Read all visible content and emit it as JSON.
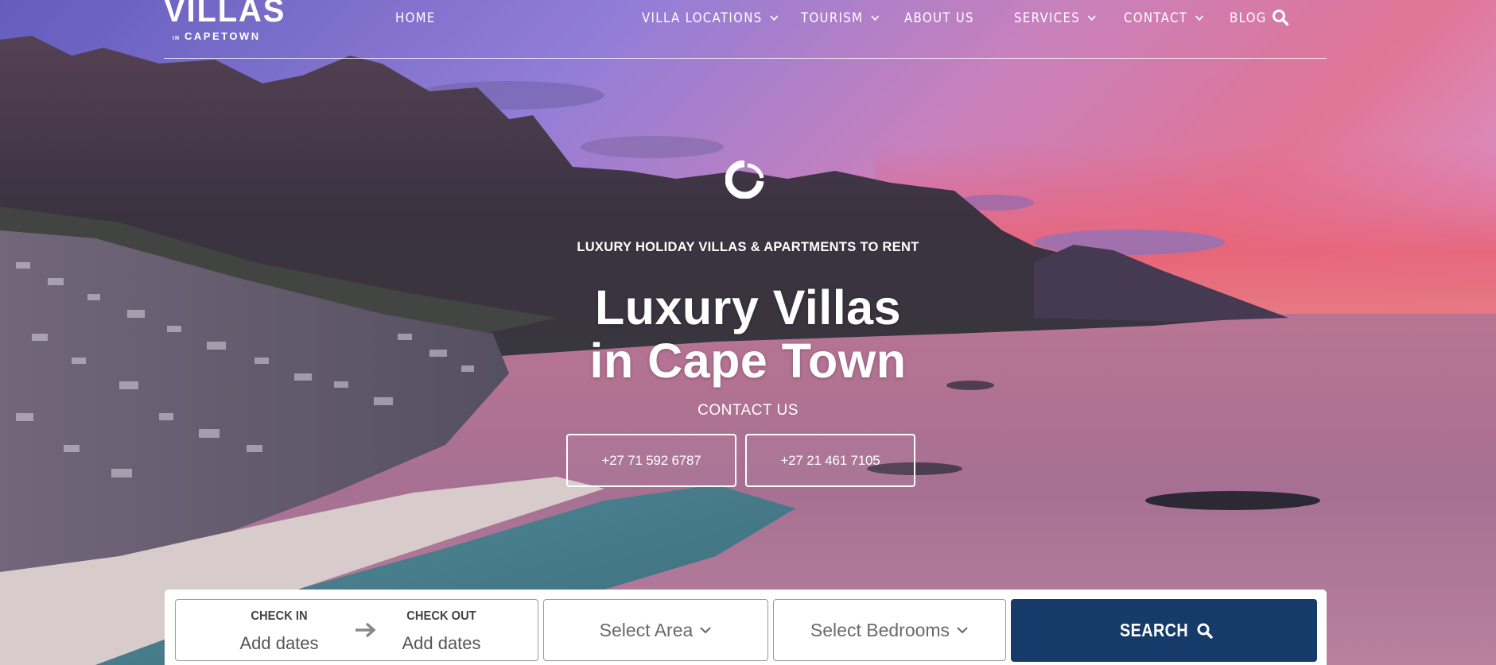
{
  "brand": {
    "logo_main": "VILLAS",
    "logo_small": "IN",
    "logo_city": "CAPETOWN"
  },
  "nav": {
    "items": [
      {
        "label": "HOME",
        "has_dropdown": false
      },
      {
        "label": "VILLA LOCATIONS",
        "has_dropdown": true
      },
      {
        "label": "TOURISM",
        "has_dropdown": true
      },
      {
        "label": "ABOUT US",
        "has_dropdown": false
      },
      {
        "label": "SERVICES",
        "has_dropdown": true
      },
      {
        "label": "CONTACT",
        "has_dropdown": true
      },
      {
        "label": "BLOG",
        "has_dropdown": false
      }
    ],
    "search_icon": "search-icon"
  },
  "hero": {
    "tagline": "LUXURY HOLIDAY VILLAS & APARTMENTS TO RENT",
    "title_line1": "Luxury Villas",
    "title_line2": "in Cape Town",
    "contact_label": "CONTACT US",
    "phone_1": "+27 71 592 6787",
    "phone_2": "+27 21 461 7105"
  },
  "booking": {
    "check_in_label": "CHECK IN",
    "check_in_value": "Add dates",
    "check_out_label": "CHECK OUT",
    "check_out_value": "Add dates",
    "area_placeholder": "Select Area",
    "bedrooms_placeholder": "Select Bedrooms",
    "search_label": "SEARCH"
  },
  "colors": {
    "search_button": "#163b6a",
    "text_white": "#ffffff"
  }
}
